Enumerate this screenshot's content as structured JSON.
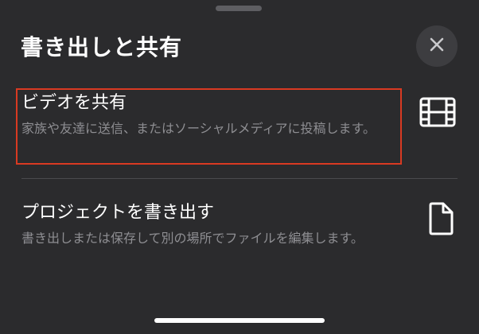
{
  "sheet": {
    "title": "書き出しと共有",
    "close_icon": "close-icon"
  },
  "options": [
    {
      "title": "ビデオを共有",
      "description": "家族や友達に送信、またはソーシャルメディアに投稿します。",
      "icon": "film-icon",
      "highlighted": true,
      "highlight_color": "#d93a22"
    },
    {
      "title": "プロジェクトを書き出す",
      "description": "書き出しまたは保存して別の場所でファイルを編集します。",
      "icon": "document-icon",
      "highlighted": false
    }
  ],
  "colors": {
    "background": "#2b2b2d",
    "secondary_text": "#8e8e92",
    "close_button": "#3d3d40"
  }
}
